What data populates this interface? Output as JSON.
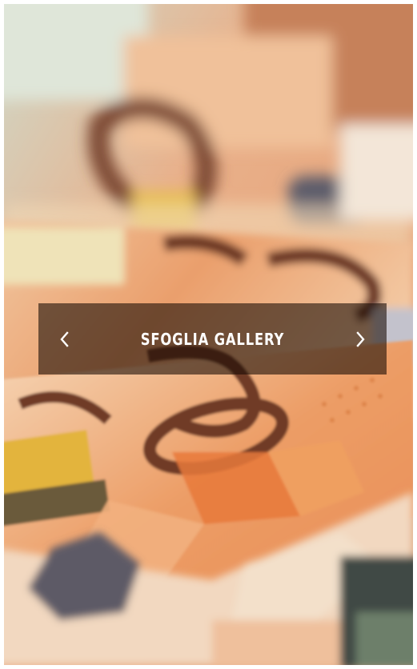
{
  "gallery": {
    "title": "SFOGLIA GALLERY",
    "prev_icon": "chevron-left-icon",
    "next_icon": "chevron-right-icon"
  },
  "background": {
    "subject": "50-euro-banknotes",
    "colors": {
      "note_orange": "#e39866",
      "note_cream": "#f3ddc4",
      "ink_brown": "#6e3a22",
      "emblem_gray": "#5d5a66",
      "accent_yellow": "#e6b640"
    }
  }
}
